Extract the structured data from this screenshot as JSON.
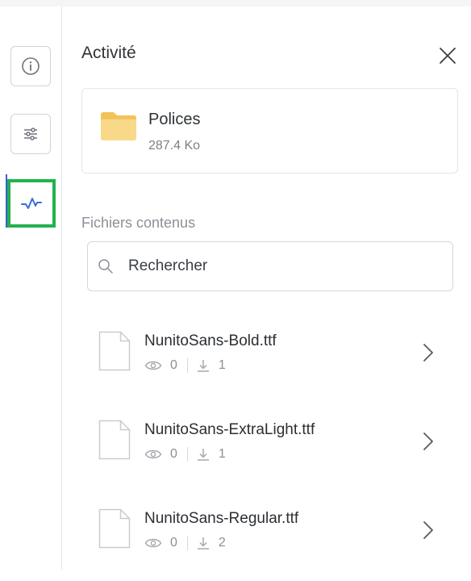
{
  "panel": {
    "title": "Activité"
  },
  "rail": {
    "items": [
      {
        "icon": "info-icon"
      },
      {
        "icon": "sliders-icon"
      },
      {
        "icon": "activity-icon",
        "active": true
      }
    ],
    "highlight_color": "#22b24c",
    "active_bar_color": "#3b5bdb"
  },
  "folder": {
    "name": "Polices",
    "size": "287.4 Ko",
    "icon": "folder-icon",
    "color": "#f6d37a"
  },
  "files_section": {
    "label": "Fichiers contenus",
    "search_placeholder": "Rechercher",
    "files": [
      {
        "name": "NunitoSans-Bold.ttf",
        "views": "0",
        "downloads": "1"
      },
      {
        "name": "NunitoSans-ExtraLight.ttf",
        "views": "0",
        "downloads": "1"
      },
      {
        "name": "NunitoSans-Regular.ttf",
        "views": "0",
        "downloads": "2"
      }
    ]
  }
}
